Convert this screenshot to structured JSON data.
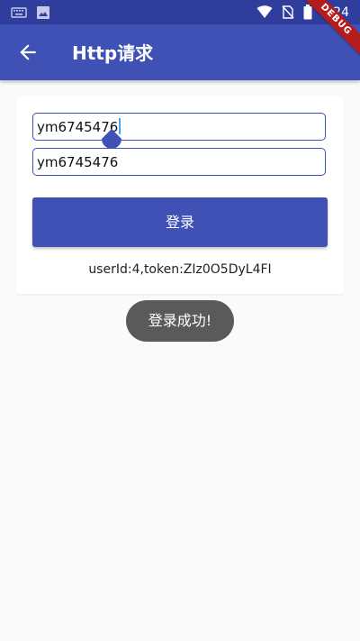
{
  "status_bar": {
    "time": "8:24",
    "icons": [
      "keyboard-icon",
      "image-icon",
      "wifi-icon",
      "no-sim-icon",
      "battery-icon"
    ]
  },
  "app_bar": {
    "title": "Http请求",
    "back_icon": "arrow-left-icon",
    "background": "#3f51b5",
    "debug_banner": "DEBUG"
  },
  "form": {
    "username_value": "ym6745476",
    "password_value": "ym6745476",
    "login_button_label": "登录",
    "result_text": "userId:4,token:ZIz0O5DyL4FI"
  },
  "toast": {
    "message": "登录成功!"
  }
}
